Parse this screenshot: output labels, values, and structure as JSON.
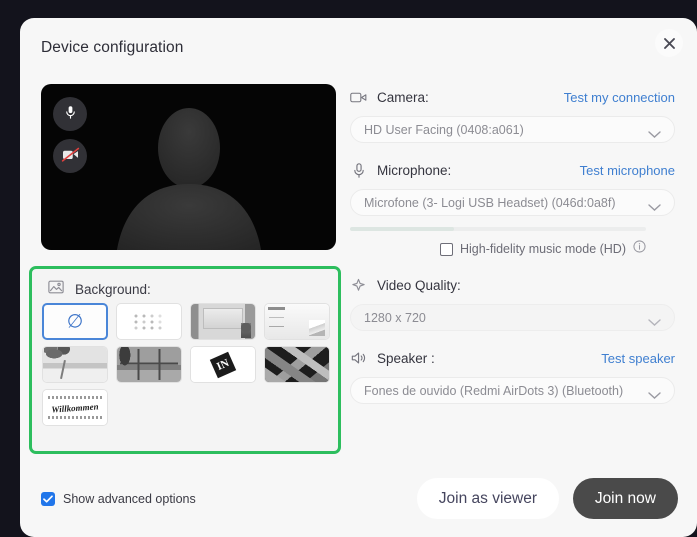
{
  "dialog": {
    "title": "Device configuration",
    "close_icon": "close-icon"
  },
  "preview": {
    "mic_icon": "microphone-icon",
    "camera_off_icon": "camera-off-icon",
    "avatar_icon": "person-silhouette-icon"
  },
  "background": {
    "label": "Background:",
    "icon": "image-icon",
    "thumbnails": [
      {
        "name": "none",
        "kind": "none",
        "selected": true
      },
      {
        "name": "blur",
        "kind": "blur",
        "selected": false
      },
      {
        "name": "gray-room",
        "kind": "room",
        "selected": false
      },
      {
        "name": "white-shelf-room",
        "kind": "shelf",
        "selected": false
      },
      {
        "name": "beach-palms",
        "kind": "beach",
        "selected": false
      },
      {
        "name": "window-ocean-view",
        "kind": "window",
        "selected": false
      },
      {
        "name": "white-logo",
        "kind": "logo",
        "selected": false,
        "mark": "IN"
      },
      {
        "name": "dark-collage",
        "kind": "collage",
        "selected": false
      },
      {
        "name": "willkommen-sign",
        "kind": "welcome",
        "selected": false,
        "text": "Willkommen"
      }
    ]
  },
  "camera": {
    "label": "Camera:",
    "icon": "video-camera-icon",
    "test_link": "Test my connection",
    "value": "HD User Facing (0408:a061)"
  },
  "microphone": {
    "label": "Microphone:",
    "icon": "microphone-icon",
    "test_link": "Test microphone",
    "value": "Microfone (3- Logi USB Headset) (046d:0a8f)",
    "level_percent": 35,
    "hifi_label": "High-fidelity music mode (HD)",
    "hifi_checked": false,
    "info_icon": "info-icon"
  },
  "video_quality": {
    "label": "Video Quality:",
    "icon": "sparkle-icon",
    "value": "1280 x 720"
  },
  "speaker": {
    "label": "Speaker :",
    "icon": "speaker-icon",
    "test_link": "Test speaker",
    "value": "Fones de ouvido (Redmi AirDots 3) (Bluetooth)"
  },
  "footer": {
    "advanced_label": "Show advanced options",
    "advanced_checked": true,
    "join_viewer_label": "Join as viewer",
    "join_now_label": "Join now"
  },
  "colors": {
    "accent_blue": "#3f7fd0",
    "highlight_green": "#2dbe5e",
    "primary_button": "#4a4a4a",
    "checkbox_blue": "#2176ea"
  }
}
